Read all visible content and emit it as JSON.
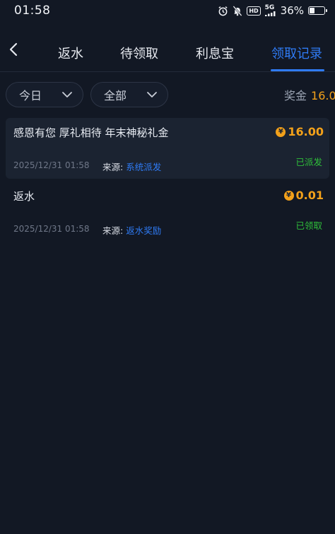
{
  "status_bar": {
    "time": "01:58",
    "network": "5G",
    "hd": "HD",
    "battery_percent": "36%",
    "battery_level": 0.36
  },
  "nav": {
    "tabs": [
      {
        "label": "返水"
      },
      {
        "label": "待领取"
      },
      {
        "label": "利息宝"
      },
      {
        "label": "领取记录"
      }
    ],
    "active_tab": "领取记录"
  },
  "filters": {
    "date": "今日",
    "type": "全部"
  },
  "bonus": {
    "label": "奖金",
    "value": "16.0"
  },
  "records": [
    {
      "title": "感恩有您 厚礼相待 年末神秘礼金",
      "amount": "16.00",
      "time": "2025/12/31 01:58",
      "source_label": "来源:",
      "source_value": "系统派发",
      "status": "已派发"
    },
    {
      "title": "返水",
      "amount": "0.01",
      "time": "2025/12/31 01:58",
      "source_label": "来源:",
      "source_value": "返水奖励",
      "status": "已领取"
    }
  ],
  "colors": {
    "background": "#121824",
    "accent_blue": "#2f7bf5",
    "gold": "#f3a11a",
    "status_green": "#2fbf3a"
  }
}
